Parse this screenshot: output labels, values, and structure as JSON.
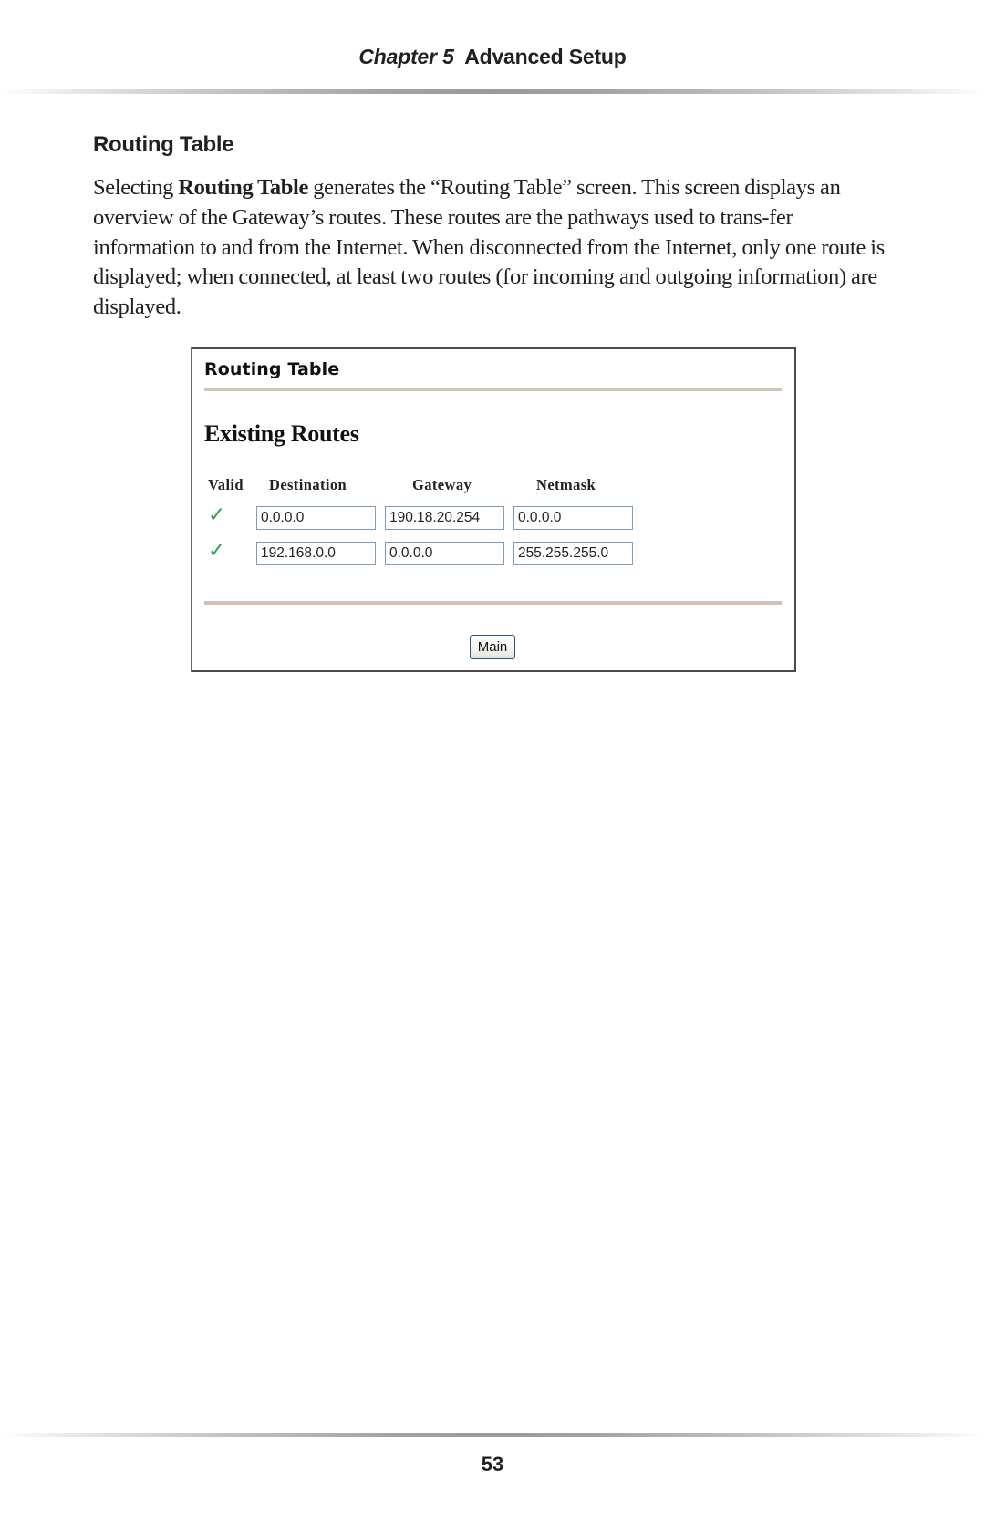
{
  "running_head": {
    "chapter": "Chapter 5",
    "title": "Advanced Setup"
  },
  "section": {
    "heading": "Routing Table",
    "paragraph": {
      "pre": "Selecting ",
      "bold": "Routing Table",
      "post": " generates the “Routing Table” screen. This screen displays an overview of the Gateway’s routes. These routes are the pathways used to trans-fer information to and from the Internet. When disconnected from the Internet, only one route is displayed; when connected, at least two routes (for incoming and outgoing information) are displayed."
    }
  },
  "screenshot": {
    "title": "Routing Table",
    "subtitle": "Existing Routes",
    "columns": [
      "Valid",
      "Destination",
      "Gateway",
      "Netmask"
    ],
    "valid_icon": "✓",
    "valid_color": "#2aa04b",
    "routes": [
      {
        "valid": true,
        "destination": "0.0.0.0",
        "gateway": "190.18.20.254",
        "netmask": "0.0.0.0"
      },
      {
        "valid": true,
        "destination": "192.168.0.0",
        "gateway": "0.0.0.0",
        "netmask": "255.255.255.0"
      }
    ],
    "main_button": "Main"
  },
  "footer": {
    "page_number": "53"
  }
}
